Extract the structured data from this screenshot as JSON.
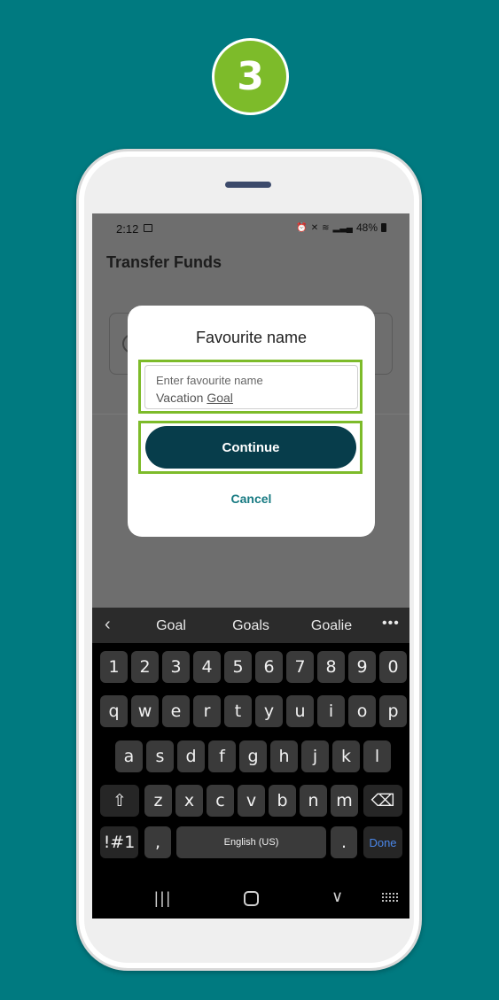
{
  "step": {
    "number": "3"
  },
  "status_bar": {
    "time": "2:12",
    "battery": "48%"
  },
  "app": {
    "title": "Transfer Funds"
  },
  "dialog": {
    "title": "Favourite name",
    "input_placeholder": "Enter favourite name",
    "input_value_prefix": "Vacation ",
    "input_value_underlined": "Goal",
    "continue_label": "Continue",
    "cancel_label": "Cancel"
  },
  "keyboard": {
    "suggestions": [
      "Goal",
      "Goals",
      "Goalie"
    ],
    "more": "•••",
    "back": "‹",
    "row_numbers": [
      "1",
      "2",
      "3",
      "4",
      "5",
      "6",
      "7",
      "8",
      "9",
      "0"
    ],
    "row_top": [
      "q",
      "w",
      "e",
      "r",
      "t",
      "y",
      "u",
      "i",
      "o",
      "p"
    ],
    "row_middle": [
      "a",
      "s",
      "d",
      "f",
      "g",
      "h",
      "j",
      "k",
      "l"
    ],
    "row_bottom": [
      "z",
      "x",
      "c",
      "v",
      "b",
      "n",
      "m"
    ],
    "shift": "⇧",
    "backspace": "⌫",
    "symbols": "!#1",
    "comma": ",",
    "space": "English (US)",
    "period": ".",
    "done": "Done"
  },
  "nav": {
    "recent": "|||",
    "down": "∨"
  },
  "colors": {
    "background": "#007A80",
    "accent_green": "#7DBB2A",
    "button_dark": "#073D4B",
    "link_teal": "#177A82"
  }
}
